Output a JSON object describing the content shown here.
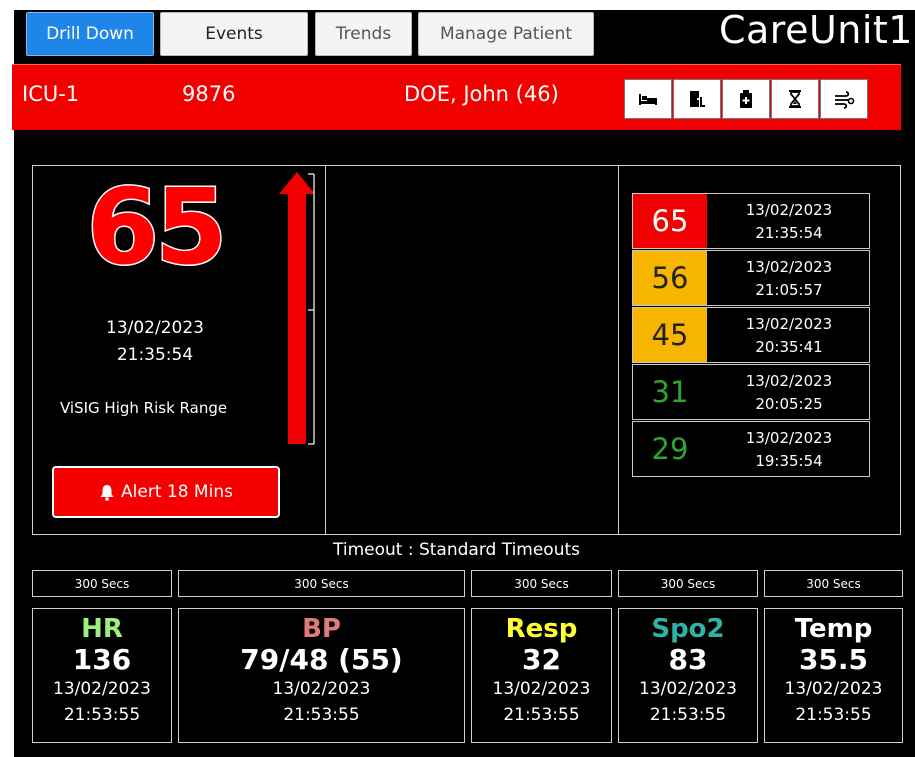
{
  "tabs": [
    {
      "label": "Drill Down",
      "active": true
    },
    {
      "label": "Events",
      "active": false
    },
    {
      "label": "Trends",
      "active": false
    },
    {
      "label": "Manage Patient",
      "active": false
    }
  ],
  "app_title": "CareUnit1",
  "banner": {
    "bed": "ICU-1",
    "patient_id": "9876",
    "patient_name": "DOE, John (46)",
    "color": "#f20000",
    "icons": [
      "bed-icon",
      "exit-door-icon",
      "clipboard-icon",
      "hourglass-icon",
      "ventilator-icon"
    ]
  },
  "score": {
    "value": "65",
    "date": "13/02/2023",
    "time": "21:35:54",
    "range_label": "ViSIG High Risk Range",
    "alert_label": "Alert 18 Mins",
    "trend": "up"
  },
  "history": [
    {
      "value": "65",
      "date": "13/02/2023",
      "time": "21:35:54",
      "level": "red"
    },
    {
      "value": "56",
      "date": "13/02/2023",
      "time": "21:05:57",
      "level": "amber"
    },
    {
      "value": "45",
      "date": "13/02/2023",
      "time": "20:35:41",
      "level": "amber"
    },
    {
      "value": "31",
      "date": "13/02/2023",
      "time": "20:05:25",
      "level": "green"
    },
    {
      "value": "29",
      "date": "13/02/2023",
      "time": "19:35:54",
      "level": "green"
    }
  ],
  "level_colors": {
    "red": "#f00000",
    "amber": "#f7b500",
    "green": "#2ea62e"
  },
  "timeout": {
    "title": "Timeout : Standard Timeouts",
    "values": [
      "300 Secs",
      "300 Secs",
      "300 Secs",
      "300 Secs",
      "300 Secs"
    ]
  },
  "vitals": [
    {
      "label": "HR",
      "value": "136",
      "date": "13/02/2023",
      "time": "21:53:55",
      "color": "#9cf07c"
    },
    {
      "label": "BP",
      "value": "79/48 (55)",
      "date": "13/02/2023",
      "time": "21:53:55",
      "color": "#e07b79"
    },
    {
      "label": "Resp",
      "value": "32",
      "date": "13/02/2023",
      "time": "21:53:55",
      "color": "#ffff33"
    },
    {
      "label": "Spo2",
      "value": "83",
      "date": "13/02/2023",
      "time": "21:53:55",
      "color": "#2fb3a6"
    },
    {
      "label": "Temp",
      "value": "35.5",
      "date": "13/02/2023",
      "time": "21:53:55",
      "color": "#ffffff"
    }
  ]
}
